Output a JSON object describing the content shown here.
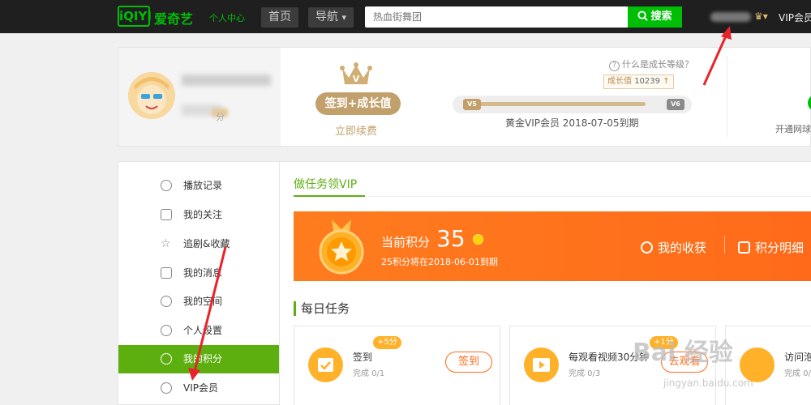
{
  "header": {
    "logo_text": "iQIYI",
    "brand": "爱奇艺",
    "brand_sub": "个人中心",
    "nav_home": "首页",
    "nav_guide": "导航",
    "nav_guide_arrow": "▾",
    "search_placeholder": "热血街舞团",
    "search_button": "搜索",
    "vip_member": "VIP会员",
    "vip_badge_icon": "crown-icon"
  },
  "profile": {
    "score_label": "分",
    "sign_button": "签到+成长值",
    "renew_link": "立即续费",
    "help_text": "什么是成长等级？",
    "help_icon": "?",
    "growth_label": "成长值",
    "growth_value": "10239",
    "growth_arrow": "↑",
    "level_left": "V5",
    "level_right": "V6",
    "growth_progress": 0.84,
    "expire_text": "黄金VIP会员  2018-07-05到期",
    "open_text": "开通网球"
  },
  "sidebar": {
    "items": [
      {
        "label": "播放记录",
        "icon": "clock-icon",
        "active": false
      },
      {
        "label": "我的关注",
        "icon": "book-icon",
        "active": false
      },
      {
        "label": "追剧&收藏",
        "icon": "star-icon",
        "active": false
      },
      {
        "label": "我的消息",
        "icon": "mail-icon",
        "active": false
      },
      {
        "label": "我的空间",
        "icon": "person-icon",
        "active": false
      },
      {
        "label": "个人设置",
        "icon": "gear-icon",
        "active": false
      },
      {
        "label": "我的积分",
        "icon": "coin-icon",
        "active": true
      },
      {
        "label": "VIP会员",
        "icon": "vip-icon",
        "active": false
      }
    ]
  },
  "main": {
    "tab": "做任务领VIP",
    "banner": {
      "current_label": "当前积分",
      "current_value": "35",
      "expire_text": "25积分将在2018-06-01到期",
      "link_harvest": "我的收获",
      "link_detail": "积分明细"
    },
    "daily_title": "每日任务",
    "cards": [
      {
        "title": "签到",
        "badge": "+5分",
        "progress": "完成 0/1",
        "button": "签到",
        "icon": "calendar-check-icon"
      },
      {
        "title": "每观看视频30分钟",
        "badge": "+1分",
        "progress": "完成 0/3",
        "button": "去观看",
        "icon": "play-icon"
      },
      {
        "title": "访问泡",
        "badge": "",
        "progress": "完成 0/",
        "button": "",
        "icon": "bubble-icon"
      }
    ]
  },
  "watermark": {
    "main": "Bai 经验",
    "sub": "jingyan.baidu.com"
  },
  "colors": {
    "brand_green": "#00be06",
    "sidebar_active": "#5daf10",
    "banner_orange": "#ff6a1a",
    "gold": "#c2a06b",
    "arrow_red": "#e8242b"
  }
}
